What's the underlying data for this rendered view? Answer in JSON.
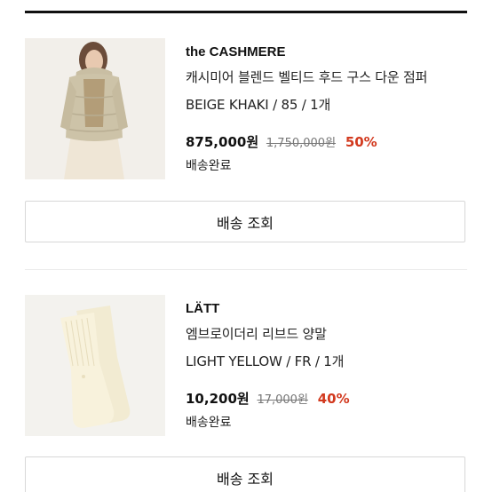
{
  "orders": [
    {
      "brand": "the CASHMERE",
      "product_name": "캐시미어 블렌드 벨티드 후드 구스 다운 점퍼",
      "option": "BEIGE KHAKI  /  85  /  1개",
      "price_current": "875,000원",
      "price_original": "1,750,000원",
      "discount": "50%",
      "status": "배송완료",
      "track_label": "배송 조회",
      "image_icon": "beige-down-jacket-photo"
    },
    {
      "brand": "LÄTT",
      "product_name": "엠브로이더리 리브드 양말",
      "option": "LIGHT YELLOW  /  FR  /  1개",
      "price_current": "10,200원",
      "price_original": "17,000원",
      "discount": "40%",
      "status": "배송완료",
      "track_label": "배송 조회",
      "image_icon": "light-yellow-socks-photo"
    }
  ],
  "colors": {
    "discount": "#d2391e",
    "text": "#111111",
    "muted": "#777777",
    "border": "#d7d7d7"
  }
}
